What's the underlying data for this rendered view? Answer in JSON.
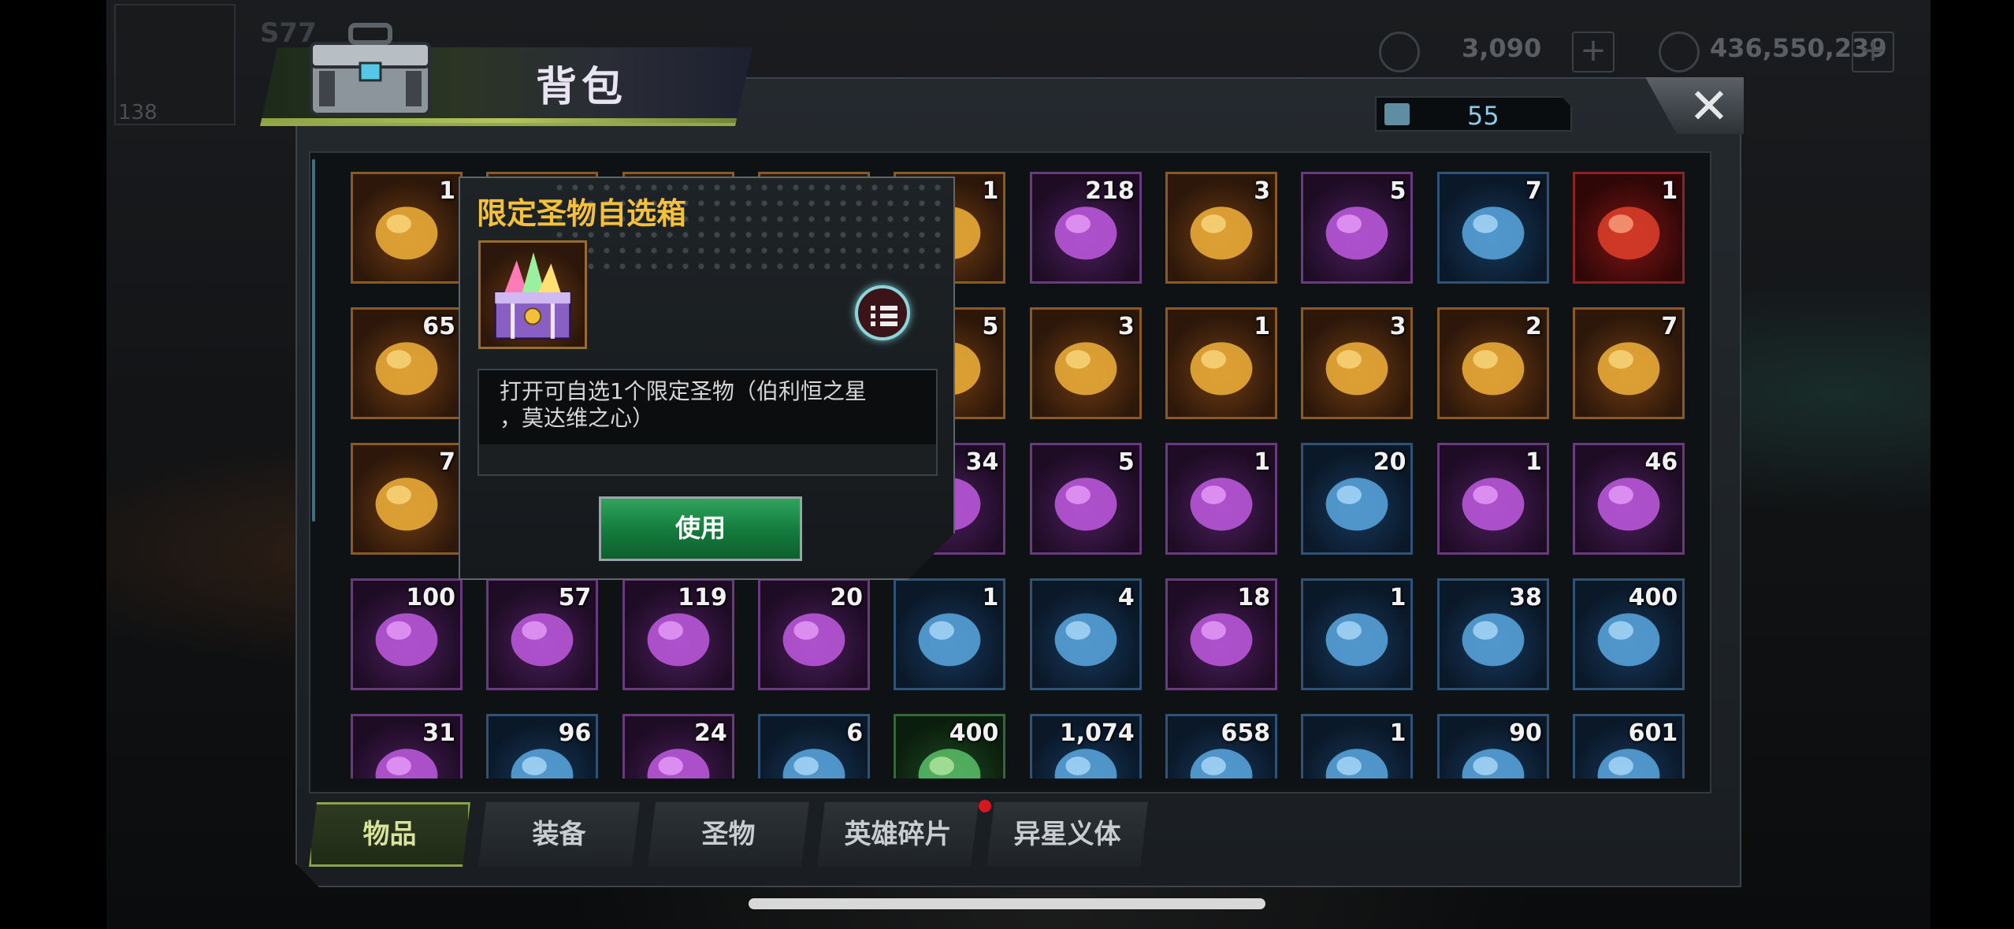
{
  "window": {
    "title": "背包"
  },
  "scene": {
    "resource_1": "3,090",
    "resource_2": "436,550,239",
    "player_level": "138",
    "player_name": "S77"
  },
  "capacity": {
    "value": "55"
  },
  "tooltip": {
    "title": "限定圣物自选箱",
    "description_line1": "打开可自选1个限定圣物（伯利恒之星",
    "description_line2": "，莫达维之心）",
    "use_label": "使用"
  },
  "items": [
    {
      "count": "1",
      "rarity": "orange",
      "icon": "crystal-chest-icon"
    },
    {
      "count": "",
      "rarity": "orange",
      "icon": "hidden-item"
    },
    {
      "count": "",
      "rarity": "orange",
      "icon": "hidden-item"
    },
    {
      "count": "",
      "rarity": "orange",
      "icon": "hidden-item"
    },
    {
      "count": "1",
      "rarity": "orange",
      "icon": "card-II-icon"
    },
    {
      "count": "218",
      "rarity": "purple",
      "icon": "gadget-icon"
    },
    {
      "count": "3",
      "rarity": "orange",
      "icon": "speedup-24h-icon"
    },
    {
      "count": "5",
      "rarity": "purple",
      "icon": "speedup-12h-icon"
    },
    {
      "count": "7",
      "rarity": "blue",
      "icon": "speedup-4h-icon"
    },
    {
      "count": "1",
      "rarity": "red",
      "icon": "pyramid-icon"
    },
    {
      "count": "65",
      "rarity": "orange",
      "icon": "golden-egg-icon"
    },
    {
      "count": "",
      "rarity": "orange",
      "icon": "hidden-item"
    },
    {
      "count": "",
      "rarity": "orange",
      "icon": "hidden-item"
    },
    {
      "count": "",
      "rarity": "orange",
      "icon": "hidden-item"
    },
    {
      "count": "5",
      "rarity": "orange",
      "icon": "frame-icon"
    },
    {
      "count": "3",
      "rarity": "orange",
      "icon": "golden-leaf-icon"
    },
    {
      "count": "1",
      "rarity": "orange",
      "icon": "chip-icon"
    },
    {
      "count": "3",
      "rarity": "orange",
      "icon": "purple-skull-icon"
    },
    {
      "count": "2",
      "rarity": "orange",
      "icon": "green-creature-icon"
    },
    {
      "count": "7",
      "rarity": "orange",
      "icon": "silver-coin-icon"
    },
    {
      "count": "7",
      "rarity": "orange",
      "icon": "hazard-badge-icon"
    },
    {
      "count": "",
      "rarity": "orange",
      "icon": "hidden-item"
    },
    {
      "count": "",
      "rarity": "orange",
      "icon": "hidden-item"
    },
    {
      "count": "",
      "rarity": "orange",
      "icon": "hidden-item"
    },
    {
      "count": "34",
      "rarity": "purple",
      "icon": "scroll-icon"
    },
    {
      "count": "5",
      "rarity": "purple",
      "icon": "pumpkin-icon"
    },
    {
      "count": "1",
      "rarity": "purple",
      "icon": "shorts-icon"
    },
    {
      "count": "20",
      "rarity": "blue",
      "icon": "cocktail-icon"
    },
    {
      "count": "1",
      "rarity": "purple",
      "icon": "fish-icon"
    },
    {
      "count": "46",
      "rarity": "purple",
      "icon": "purple-crystal-icon"
    },
    {
      "count": "100",
      "rarity": "purple",
      "icon": "film-reel-icon"
    },
    {
      "count": "57",
      "rarity": "purple",
      "icon": "bottle-cap-icon"
    },
    {
      "count": "119",
      "rarity": "purple",
      "icon": "poker-chip-icon"
    },
    {
      "count": "20",
      "rarity": "purple",
      "icon": "police-badge-icon"
    },
    {
      "count": "1",
      "rarity": "blue",
      "icon": "boxing-glove-icon"
    },
    {
      "count": "4",
      "rarity": "blue",
      "icon": "crystal-ball-icon"
    },
    {
      "count": "18",
      "rarity": "purple",
      "icon": "neon-sword-icon"
    },
    {
      "count": "1",
      "rarity": "blue",
      "icon": "helmet-icon"
    },
    {
      "count": "38",
      "rarity": "blue",
      "icon": "bunny-badge-icon"
    },
    {
      "count": "400",
      "rarity": "blue",
      "icon": "bolt-icon"
    },
    {
      "count": "31",
      "rarity": "purple",
      "icon": "xmas-wreath-icon"
    },
    {
      "count": "96",
      "rarity": "blue",
      "icon": "silver-bar-icon"
    },
    {
      "count": "24",
      "rarity": "purple",
      "icon": "potion-icon"
    },
    {
      "count": "6",
      "rarity": "blue",
      "icon": "box-icon"
    },
    {
      "count": "400",
      "rarity": "green",
      "icon": "building-icon"
    },
    {
      "count": "1,074",
      "rarity": "blue",
      "icon": "cinema-ticket-icon"
    },
    {
      "count": "658",
      "rarity": "blue",
      "icon": "clock-icon"
    },
    {
      "count": "1",
      "rarity": "blue",
      "icon": "b-token-icon"
    },
    {
      "count": "90",
      "rarity": "blue",
      "icon": "red-chip-icon"
    },
    {
      "count": "601",
      "rarity": "blue",
      "icon": "bullet-icon"
    }
  ],
  "tabs": [
    {
      "label": "物品",
      "active": true
    },
    {
      "label": "装备",
      "active": false
    },
    {
      "label": "圣物",
      "active": false
    },
    {
      "label": "英雄碎片",
      "active": false,
      "notify": true
    },
    {
      "label": "异星义体",
      "active": false
    }
  ],
  "colors": {
    "accent_gold": "#f5c03a",
    "button_green": "#1e8c47",
    "tab_active_border": "#8ba34a",
    "notify_red": "#d9161d"
  }
}
